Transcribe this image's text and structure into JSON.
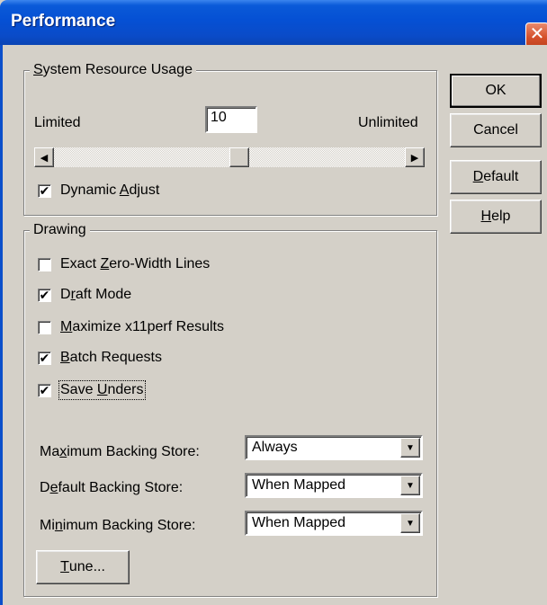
{
  "window": {
    "title": "Performance",
    "close_glyph": "✕"
  },
  "buttons": {
    "ok": "OK",
    "cancel": "Cancel",
    "default_pre": "",
    "default_u": "D",
    "default_post": "efault",
    "help_pre": "",
    "help_u": "H",
    "help_post": "elp"
  },
  "resource": {
    "legend_u": "S",
    "legend_post": "ystem Resource Usage",
    "limited": "Limited",
    "unlimited": "Unlimited",
    "value": "10",
    "slider_fraction": 0.53,
    "dynamic_pre": "Dynamic ",
    "dynamic_u": "A",
    "dynamic_post": "djust",
    "dynamic_checked": "✔"
  },
  "drawing": {
    "legend": "Drawing",
    "exact_pre": "Exact ",
    "exact_u": "Z",
    "exact_post": "ero-Width Lines",
    "exact_checked": "",
    "draft_pre": "D",
    "draft_u": "r",
    "draft_post": "aft Mode",
    "draft_checked": "✔",
    "maximize_pre": "",
    "maximize_u": "M",
    "maximize_post": "aximize x11perf Results",
    "maximize_checked": "",
    "batch_pre": "",
    "batch_u": "B",
    "batch_post": "atch Requests",
    "batch_checked": "✔",
    "save_pre": "Save ",
    "save_u": "U",
    "save_post": "nders",
    "save_checked": "✔",
    "max_store_pre": "Ma",
    "max_store_u": "x",
    "max_store_post": "imum Backing Store:",
    "max_store_value": "Always",
    "def_store_pre": "D",
    "def_store_u": "e",
    "def_store_post": "fault Backing Store:",
    "def_store_value": "When Mapped",
    "min_store_pre": "Mi",
    "min_store_u": "n",
    "min_store_post": "imum Backing Store:",
    "min_store_value": "When Mapped",
    "tune_u": "T",
    "tune_post": "une..."
  }
}
